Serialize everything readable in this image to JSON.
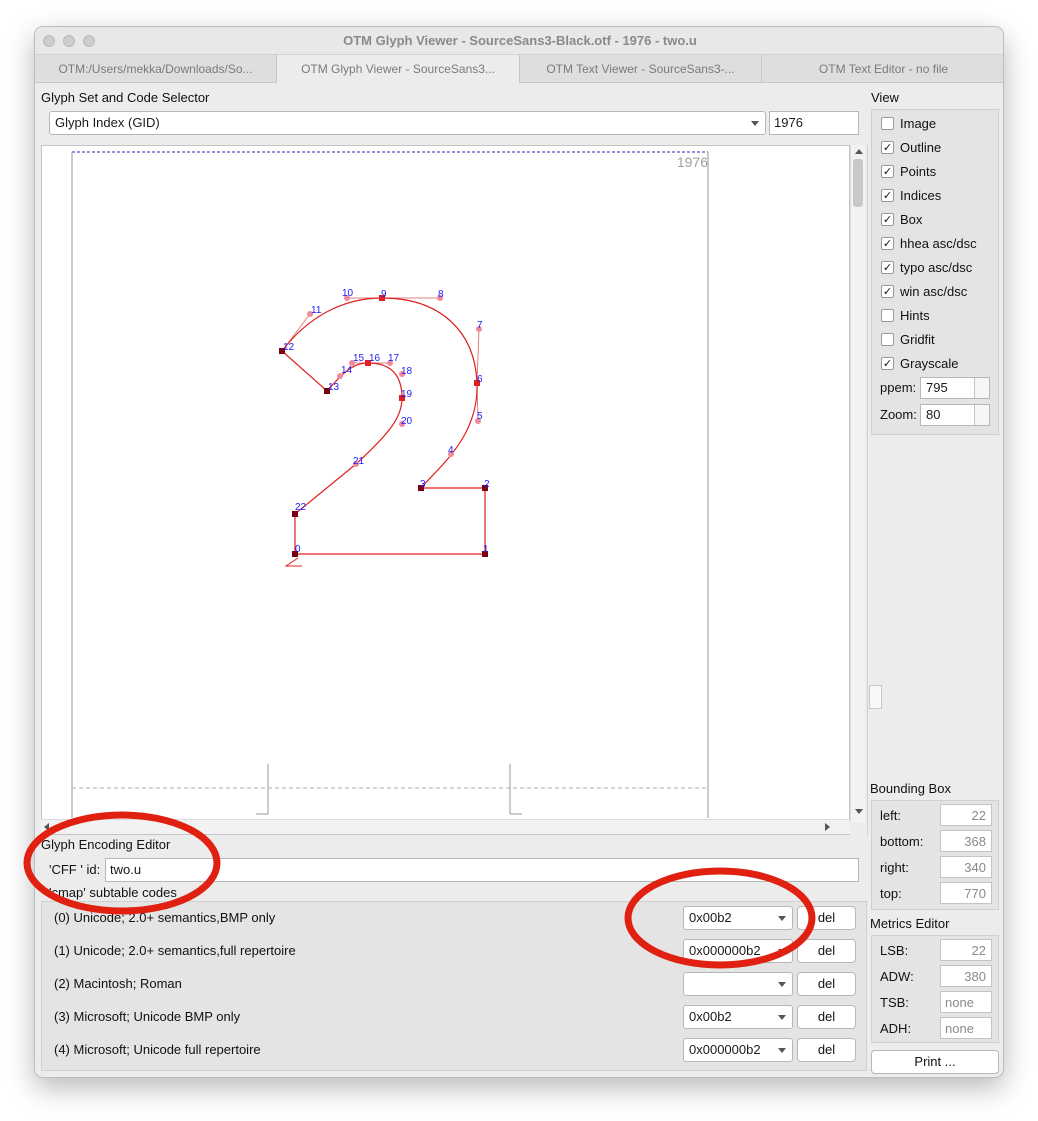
{
  "window": {
    "title": "OTM Glyph Viewer - SourceSans3-Black.otf - 1976 - two.u",
    "tabs": [
      {
        "label": "OTM:/Users/mekka/Downloads/So..."
      },
      {
        "label": "OTM Glyph Viewer - SourceSans3..."
      },
      {
        "label": "OTM Text Viewer - SourceSans3-..."
      },
      {
        "label": "OTM Text Editor - no file"
      }
    ]
  },
  "selector": {
    "heading": "Glyph Set and Code Selector",
    "mode": "Glyph Index (GID)",
    "code": "1976"
  },
  "glyph_view": {
    "gid_label": "1976",
    "point_labels": [
      "0",
      "1",
      "2",
      "3",
      "4",
      "5",
      "6",
      "7",
      "8",
      "9",
      "10",
      "11",
      "12",
      "13",
      "14",
      "15",
      "16",
      "17",
      "18",
      "19",
      "20",
      "21",
      "22"
    ]
  },
  "view": {
    "heading": "View",
    "options": [
      {
        "label": "Image",
        "checked": false
      },
      {
        "label": "Outline",
        "checked": true
      },
      {
        "label": "Points",
        "checked": true
      },
      {
        "label": "Indices",
        "checked": true
      },
      {
        "label": "Box",
        "checked": true
      },
      {
        "label": "hhea asc/dsc",
        "checked": true
      },
      {
        "label": "typo asc/dsc",
        "checked": true
      },
      {
        "label": "win asc/dsc",
        "checked": true
      },
      {
        "label": "Hints",
        "checked": false
      },
      {
        "label": "Gridfit",
        "checked": false
      },
      {
        "label": "Grayscale",
        "checked": true
      }
    ],
    "check_mark": "✓",
    "ppem_label": "ppem:",
    "ppem": "795",
    "zoom_label": "Zoom:",
    "zoom": "80"
  },
  "bounding_box": {
    "heading": "Bounding Box",
    "left_label": "left:",
    "left": "22",
    "bottom_label": "bottom:",
    "bottom": "368",
    "right_label": "right:",
    "right": "340",
    "top_label": "top:",
    "top": "770"
  },
  "metrics": {
    "heading": "Metrics Editor",
    "lsb_label": "LSB:",
    "lsb": "22",
    "adw_label": "ADW:",
    "adw": "380",
    "tsb_label": "TSB:",
    "tsb": "none",
    "adh_label": "ADH:",
    "adh": "none",
    "print_label": "Print ..."
  },
  "encoding": {
    "heading": "Glyph Encoding Editor",
    "cff_label": "'CFF ' id:",
    "cff_id": "two.u",
    "cmap_label": "'cmap' subtable codes",
    "del_label": "del",
    "rows": [
      {
        "label": "(0) Unicode; 2.0+ semantics,BMP only",
        "value": "0x00b2"
      },
      {
        "label": "(1) Unicode; 2.0+ semantics,full repertoire",
        "value": "0x000000b2"
      },
      {
        "label": "(2) Macintosh; Roman",
        "value": ""
      },
      {
        "label": "(3) Microsoft; Unicode BMP only",
        "value": "0x00b2"
      },
      {
        "label": "(4) Microsoft; Unicode full repertoire",
        "value": "0x000000b2"
      }
    ]
  },
  "colors": {
    "outline": "#e02020",
    "point_label": "#1a1aff",
    "annotation": "#e02010"
  }
}
